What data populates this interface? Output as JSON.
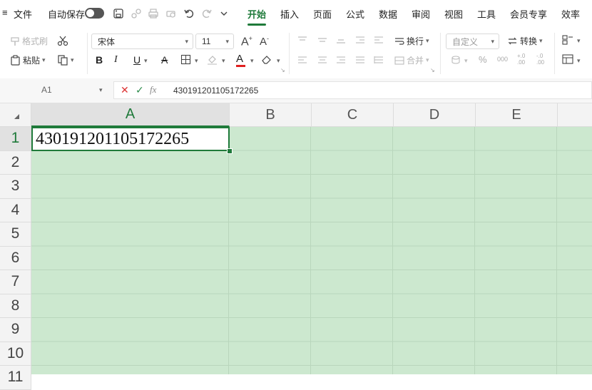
{
  "menubar": {
    "menu_icon": "≡",
    "file_label": "文件",
    "autosave_label": "自动保存",
    "tabs": [
      {
        "label": "开始",
        "active": true
      },
      {
        "label": "插入",
        "active": false
      },
      {
        "label": "页面",
        "active": false
      },
      {
        "label": "公式",
        "active": false
      },
      {
        "label": "数据",
        "active": false
      },
      {
        "label": "审阅",
        "active": false
      },
      {
        "label": "视图",
        "active": false
      },
      {
        "label": "工具",
        "active": false
      },
      {
        "label": "会员专享",
        "active": false
      },
      {
        "label": "效率",
        "active": false
      }
    ]
  },
  "ribbon": {
    "format_painter": "格式刷",
    "paste": "粘贴",
    "font_name": "宋体",
    "font_size": "11",
    "wrap": "换行",
    "merge": "合并",
    "number_format": "自定义",
    "convert": "转换",
    "bold": "B",
    "italic": "I",
    "underline": "U",
    "strike": "A",
    "font_color_letter": "A",
    "percent": "%",
    "thousands": "000",
    "dec_inc": "+.0\n.00",
    "dec_dec": "-.0\n.00"
  },
  "formulabar": {
    "cell_ref": "A1",
    "fx": "fx",
    "content": "430191201105172265"
  },
  "grid": {
    "columns": [
      "A",
      "B",
      "C",
      "D",
      "E"
    ],
    "rows": [
      "1",
      "2",
      "3",
      "4",
      "5",
      "6",
      "7",
      "8",
      "9",
      "10",
      "11"
    ],
    "cells": {
      "A1": "430191201105172265"
    }
  },
  "colors": {
    "accent": "#1f7a3a",
    "sheet_bg": "#cce8cf",
    "gridline": "#b9d6bc"
  }
}
